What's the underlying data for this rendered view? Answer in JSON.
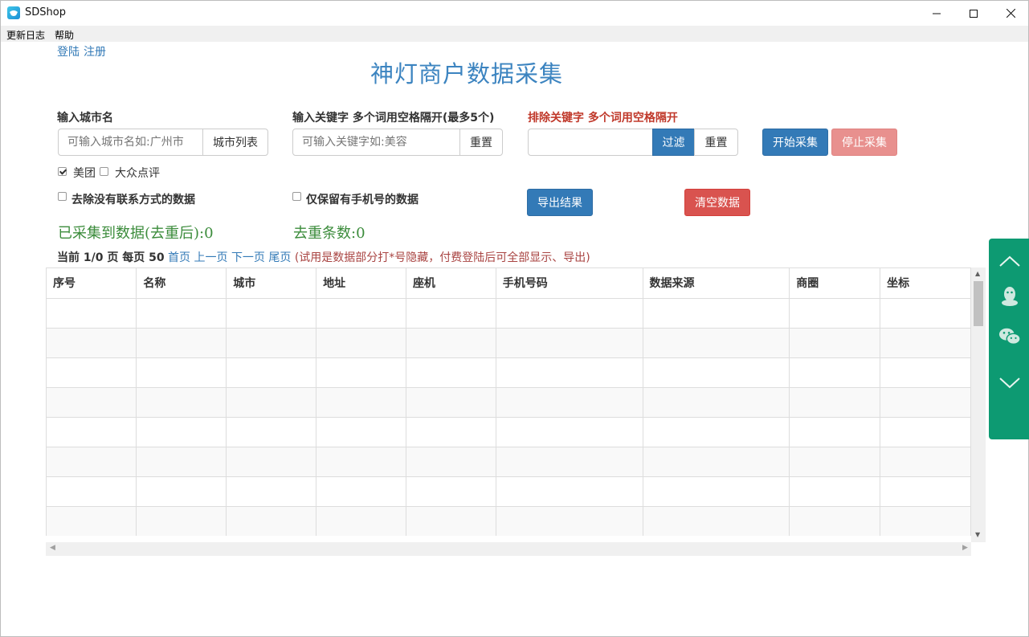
{
  "window": {
    "title": "SDShop"
  },
  "menu": {
    "items": [
      "更新日志",
      "帮助"
    ]
  },
  "auth": {
    "login": "登陆",
    "register": "注册"
  },
  "page_title": "神灯商户数据采集",
  "city": {
    "label": "输入城市名",
    "placeholder": "可输入城市名如:广州市",
    "button": "城市列表"
  },
  "keyword": {
    "label": "输入关键字 多个词用空格隔开(最多5个)",
    "placeholder": "可输入关键字如:美容",
    "reset": "重置"
  },
  "exclude": {
    "label": "排除关键字 多个词用空格隔开",
    "value": "",
    "filter": "过滤",
    "reset": "重置"
  },
  "actions": {
    "start": "开始采集",
    "stop": "停止采集",
    "export": "导出结果",
    "clear": "清空数据"
  },
  "sources": [
    {
      "label": "美团",
      "checked": true
    },
    {
      "label": "大众点评",
      "checked": false
    }
  ],
  "options": [
    {
      "label": "去除没有联系方式的数据",
      "checked": false
    },
    {
      "label": "仅保留有手机号的数据",
      "checked": false
    }
  ],
  "stats": {
    "collected": "已采集到数据(去重后):0",
    "dedup": "去重条数:0"
  },
  "pager": {
    "current": "当前 1/0 页 每页 50",
    "first": "首页",
    "prev": "上一页",
    "next": "下一页",
    "last": "尾页",
    "note": "(试用是数据部分打*号隐藏，付费登陆后可全部显示、导出)"
  },
  "table": {
    "columns": [
      "序号",
      "名称",
      "城市",
      "地址",
      "座机",
      "手机号码",
      "数据来源",
      "商圈",
      "坐标"
    ],
    "empty_rows": 8
  },
  "colors": {
    "accent": "#337ab7",
    "danger": "#d9534f",
    "side_panel": "#0d9a72",
    "stat_green": "#3c8c3c"
  },
  "side_icons": [
    "chevron-up-icon",
    "qq-icon",
    "wechat-icon",
    "chevron-down-icon"
  ]
}
